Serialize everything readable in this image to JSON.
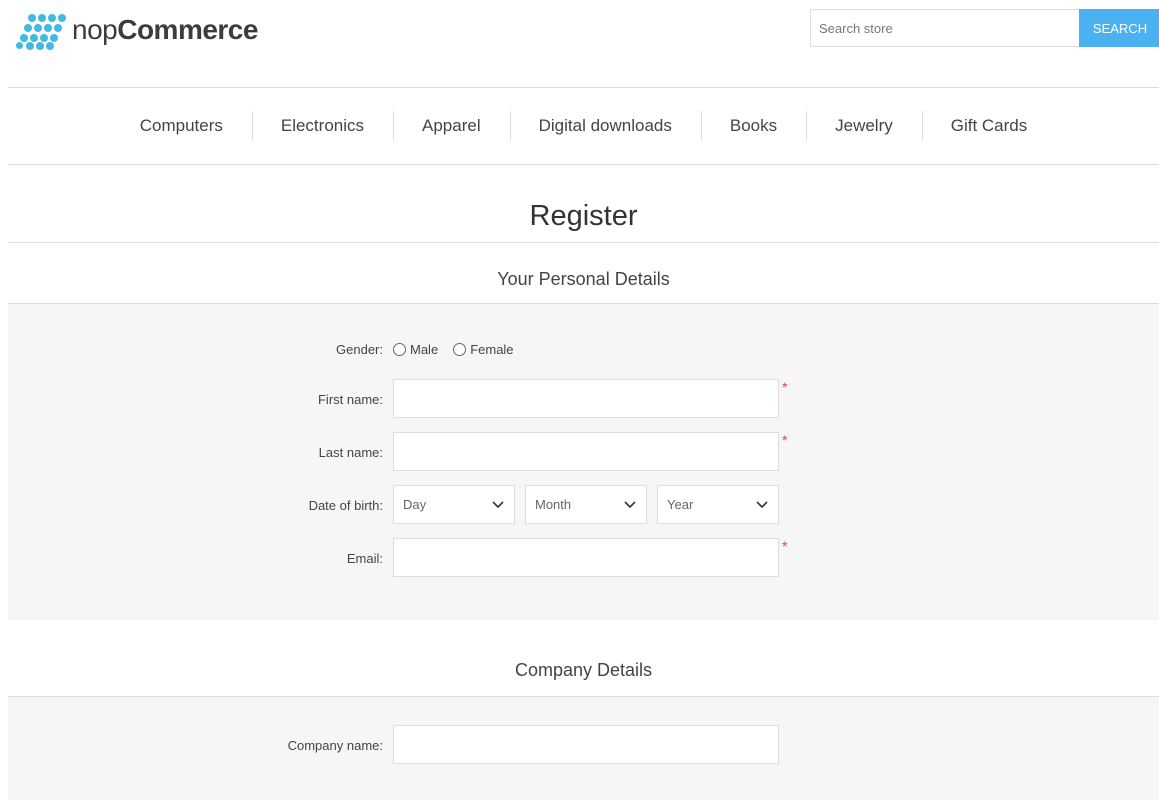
{
  "header": {
    "logo": {
      "prefix": "nop",
      "suffix": "Commerce"
    },
    "search": {
      "placeholder": "Search store",
      "button_label": "SEARCH"
    }
  },
  "menu": {
    "items": [
      "Computers",
      "Electronics",
      "Apparel",
      "Digital downloads",
      "Books",
      "Jewelry",
      "Gift Cards"
    ]
  },
  "page_title": "Register",
  "personal": {
    "title": "Your Personal Details",
    "gender_label": "Gender:",
    "gender_options": [
      "Male",
      "Female"
    ],
    "first_name_label": "First name:",
    "last_name_label": "Last name:",
    "dob_label": "Date of birth:",
    "dob_selects": [
      "Day",
      "Month",
      "Year"
    ],
    "email_label": "Email:",
    "required_mark": "*"
  },
  "company": {
    "title": "Company Details",
    "company_name_label": "Company name:"
  },
  "colors": {
    "accent": "#4ab2f1",
    "logo": "#42b9e5",
    "required": "#e4444c",
    "section_bg": "#f6f6f6"
  }
}
